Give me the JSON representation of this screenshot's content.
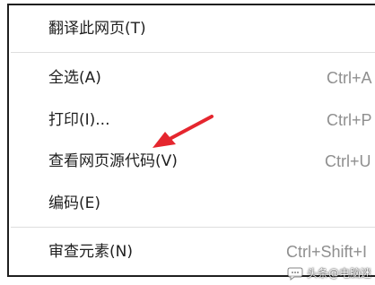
{
  "menu": {
    "items": [
      {
        "label": "翻译此网页(T)",
        "shortcut": ""
      },
      {
        "label": "全选(A)",
        "shortcut": "Ctrl+A"
      },
      {
        "label": "打印(I)...",
        "shortcut": "Ctrl+P"
      },
      {
        "label": "查看网页源代码(V)",
        "shortcut": "Ctrl+U"
      },
      {
        "label": "编码(E)",
        "shortcut": ""
      },
      {
        "label": "审查元素(N)",
        "shortcut": "Ctrl+Shift+I"
      }
    ]
  },
  "annotation": {
    "icon": "red-arrow-icon",
    "color": "#e5262e"
  },
  "watermark": {
    "text": "头条@电脑迷",
    "icon": "chat-bubble-icon"
  },
  "colors": {
    "menu_text": "#1f1f1f",
    "shortcut_text": "#8f8f8f",
    "separator": "#dedede",
    "border": "#1f1f1f",
    "background": "#ffffff"
  }
}
